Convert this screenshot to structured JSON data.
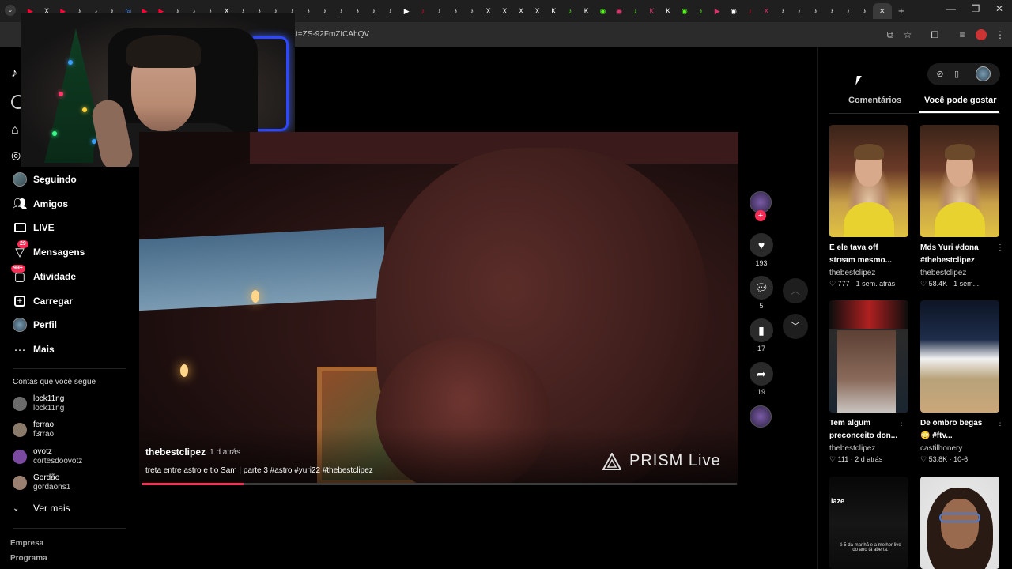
{
  "browser": {
    "url": "t=ZS-92FmZICAhQV",
    "tab_count": 53,
    "tab_colors": [
      "#ff0033",
      "#ffffff",
      "#ff0033",
      "#ffffff",
      "#ffffff",
      "#ffffff",
      "#4285f4",
      "#ff0033",
      "#ff0033",
      "#ffffff",
      "#ffffff",
      "#ffffff",
      "#ffffff",
      "#ffffff",
      "#ffffff",
      "#ffffff",
      "#ffffff",
      "#ffffff",
      "#ffffff",
      "#ffffff",
      "#ffffff",
      "#ffffff",
      "#ffffff",
      "#ffffff",
      "#ff0033",
      "#ffffff",
      "#ffffff",
      "#ffffff",
      "#ffffff",
      "#ffffff",
      "#ffffff",
      "#ffffff",
      "#ffffff",
      "#53fc18",
      "#ffffff",
      "#53fc18",
      "#e1306c",
      "#53fc18",
      "#e1306c",
      "#ffffff",
      "#53fc18",
      "#53fc18",
      "#e1306c",
      "#ffffff",
      "#ff0033",
      "#e1306c",
      "#ffffff",
      "#ffffff",
      "#ffffff",
      "#ffffff",
      "#ffffff",
      "#ffffff"
    ],
    "tab_glyphs": [
      "▶",
      "X",
      "▶",
      "♪",
      "♪",
      "♪",
      "◎",
      "▶",
      "▶",
      "♪",
      "♪",
      "♪",
      "X",
      "♪",
      "♪",
      "♪",
      "♪",
      "♪",
      "♪",
      "♪",
      "♪",
      "♪",
      "♪",
      "▶",
      "♪",
      "♪",
      "♪",
      "♪",
      "X",
      "X",
      "X",
      "X",
      "K",
      "♪",
      "K",
      "◉",
      "◉",
      "♪",
      "K",
      "K",
      "◉",
      "♪",
      "▶",
      "◉",
      "♪",
      "X",
      "♪",
      "♪",
      "♪",
      "♪",
      "♪",
      "♪"
    ],
    "new_tab": "+",
    "minimize": "—",
    "restore": "❐",
    "close": "✕"
  },
  "sidebar": {
    "items": [
      {
        "label": "Seguindo",
        "icon": "avatar-icon"
      },
      {
        "label": "Amigos",
        "icon": "friends-icon"
      },
      {
        "label": "LIVE",
        "icon": "live-icon"
      },
      {
        "label": "Mensagens",
        "icon": "messages-icon",
        "badge": "29"
      },
      {
        "label": "Atividade",
        "icon": "activity-icon",
        "badge": "99+"
      },
      {
        "label": "Carregar",
        "icon": "upload-icon"
      },
      {
        "label": "Perfil",
        "icon": "profile-icon"
      },
      {
        "label": "Mais",
        "icon": "more-icon"
      }
    ],
    "following_header": "Contas que você segue",
    "accounts": [
      {
        "name": "lock11ng",
        "handle": "lock11ng",
        "color": "#6b6b6b"
      },
      {
        "name": "ferrao",
        "handle": "f3rrao",
        "color": "#8a7a6a"
      },
      {
        "name": "ovotz",
        "handle": "cortesdoovotz",
        "color": "#7a4aa0"
      },
      {
        "name": "Gordão",
        "handle": "gordaons1",
        "color": "#9a8070"
      }
    ],
    "see_more": "Ver mais",
    "footer": [
      "Empresa",
      "Programa"
    ]
  },
  "video": {
    "author": "thebestclipez",
    "time": "· 1 d atrás",
    "caption": "treta entre astro e tio Sam | parte 3 #astro #yuri22 #thebestclipez",
    "watermark": "PRISM Live",
    "progress": 0.17
  },
  "actions": {
    "likes": "193",
    "comments": "5",
    "saves": "17",
    "shares": "19"
  },
  "right_panel": {
    "tabs": [
      "Comentários",
      "Você pode gostar"
    ],
    "active_tab": 1,
    "cards": [
      {
        "title": "E ele tava off stream mesmo...",
        "author": "thebestclipez",
        "meta": "♡ 777 · 1 sem. atrás",
        "thumb": "xmas"
      },
      {
        "title": "Mds Yuri #dona #thebestclipez",
        "author": "thebestclipez",
        "meta": "♡ 58.4K · 1 sem....",
        "thumb": "xmas"
      },
      {
        "title": "Tem algum preconceito don...",
        "author": "thebestclipez",
        "meta": "♡ 111 · 2 d atrás",
        "thumb": "phone"
      },
      {
        "title": "De ombro begas 😳 #ftv...",
        "author": "castilhonery",
        "meta": "♡ 53.8K · 10-6",
        "thumb": "beach"
      },
      {
        "title": "",
        "author": "",
        "meta": "",
        "thumb": "dark",
        "overlay": "laze",
        "overlay_sub": "é 5 da manhã e a melhor live do ano tá aberta."
      },
      {
        "title": "",
        "author": "",
        "meta": "",
        "thumb": "woman"
      }
    ]
  },
  "colors": {
    "accent": "#fe2c55",
    "bg": "#000000"
  }
}
